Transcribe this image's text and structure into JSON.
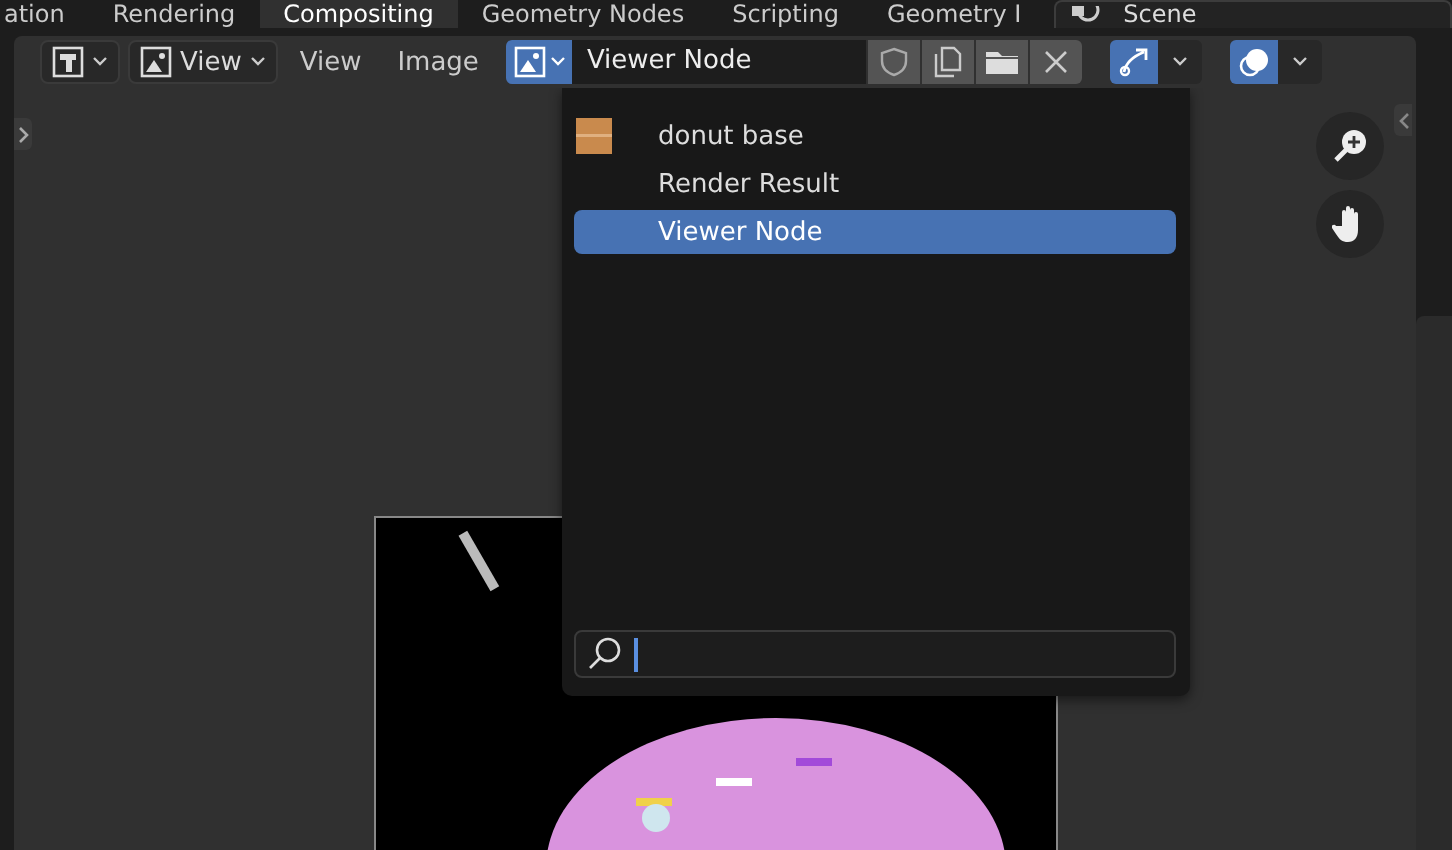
{
  "workspace_tabs": [
    {
      "label": "ation",
      "selected": false
    },
    {
      "label": "Rendering",
      "selected": false
    },
    {
      "label": "Compositing",
      "selected": true
    },
    {
      "label": "Geometry Nodes",
      "selected": false
    },
    {
      "label": "Scripting",
      "selected": false
    },
    {
      "label": "Geometry I",
      "selected": false
    }
  ],
  "scene": {
    "label": "Scene"
  },
  "header": {
    "view_mode": "View",
    "menus": [
      "View",
      "Image"
    ],
    "image_name": "Viewer Node",
    "gizmo_on": true,
    "overlay_on": true
  },
  "image_menu": {
    "items": [
      {
        "label": "donut base",
        "kind": "texture",
        "selected": false
      },
      {
        "label": "Render Result",
        "kind": "plain",
        "selected": false
      },
      {
        "label": "Viewer Node",
        "kind": "plain",
        "selected": true
      }
    ]
  }
}
